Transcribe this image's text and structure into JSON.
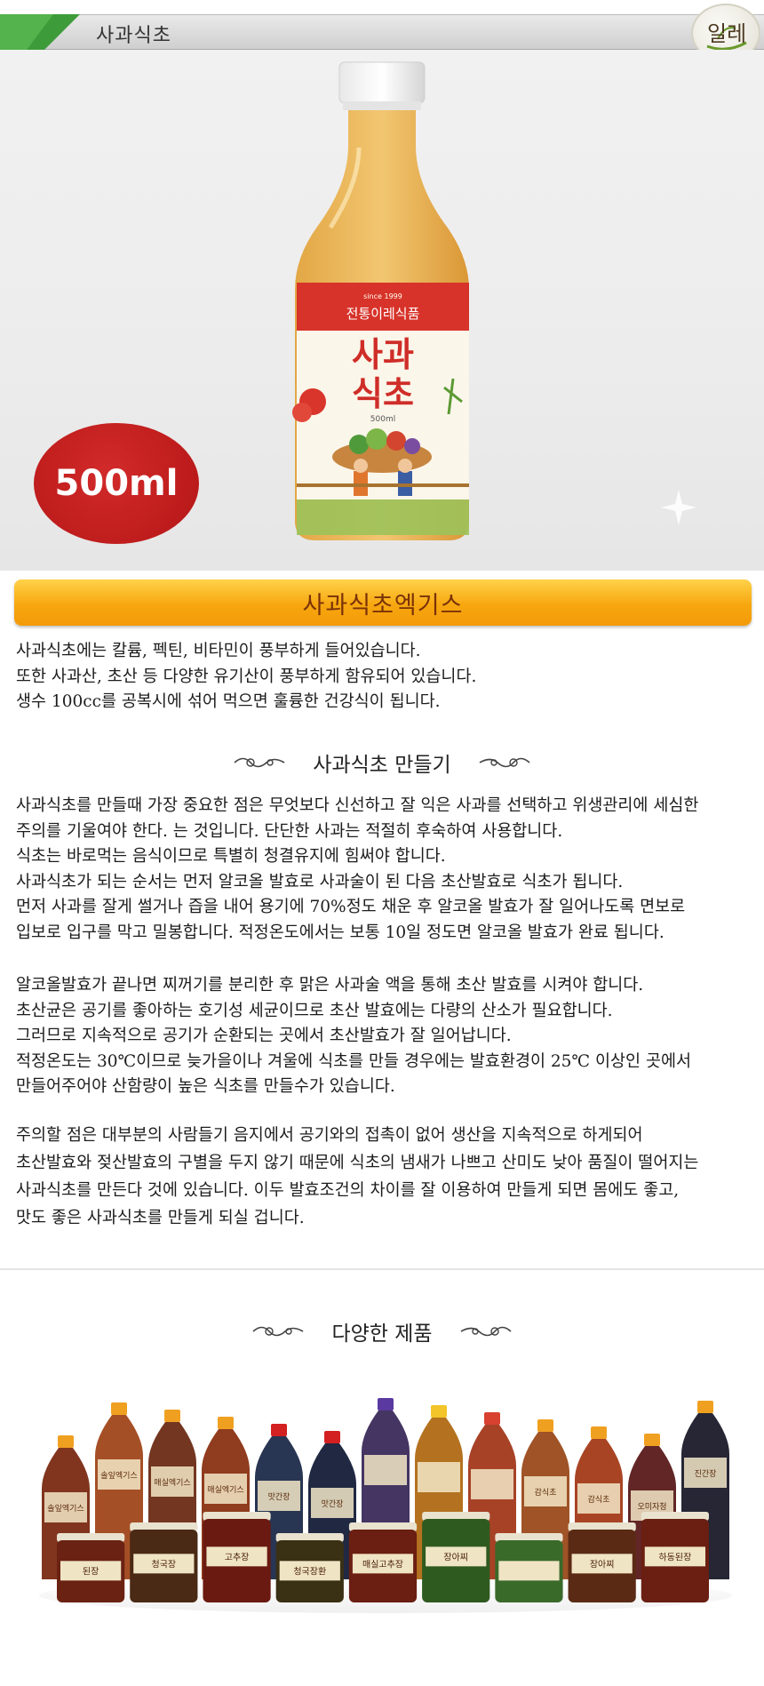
{
  "header": {
    "title": "사과식초",
    "logo_text": "일레",
    "logo_icon": "ilre-logo-icon"
  },
  "hero": {
    "label": {
      "since": "since 1999",
      "brand": "전통이레식품",
      "product_line1": "사과",
      "product_line2": "식초",
      "volume": "500ml"
    },
    "badge": "500ml"
  },
  "extract_section": {
    "heading": "사과식초엑기스",
    "lines": [
      "사과식초에는 칼륨, 펙틴, 비타민이 풍부하게 들어있습니다.",
      "또한 사과산, 초산 등 다양한 유기산이 풍부하게 함유되어 있습니다.",
      "생수 100cc를 공복시에 섞어 먹으면 훌륭한 건강식이 됩니다."
    ]
  },
  "making_section": {
    "heading": "사과식초 만들기",
    "block1": [
      "사과식초를 만들때 가장 중요한 점은 무엇보다 신선하고 잘 익은 사과를 선택하고 위생관리에 세심한",
      "주의를 기울여야 한다. 는 것입니다. 단단한 사과는 적절히 후숙하여 사용합니다.",
      "식초는 바로먹는 음식이므로 특별히 청결유지에 힘써야 합니다.",
      "사과식초가 되는 순서는 먼저 알코올 발효로 사과술이 된 다음 초산발효로 식초가 됩니다.",
      "먼저 사과를 잘게 썰거나 즙을 내어 용기에 70%정도 채운 후 알코올 발효가 잘 일어나도록 면보로",
      "입보로 입구를 막고 밀봉합니다. 적정온도에서는 보통 10일 정도면 알코올 발효가 완료 됩니다."
    ],
    "block2": [
      "알코올발효가 끝나면 찌꺼기를 분리한 후 맑은 사과술 액을 통해 초산 발효를 시켜야 합니다.",
      "초산균은 공기를 좋아하는 호기성 세균이므로 초산 발효에는 다량의 산소가 필요합니다.",
      "그러므로 지속적으로 공기가 순환되는 곳에서 초산발효가 잘 일어납니다.",
      "적정온도는 30℃이므로 늦가을이나 겨울에 식초를 만들 경우에는 발효환경이 25℃ 이상인 곳에서",
      "만들어주어야 산함량이 높은 식초를 만들수가 있습니다."
    ],
    "block3": [
      "주의할 점은 대부분의 사람들기 음지에서 공기와의 접촉이 없어 생산을 지속적으로 하게되어",
      "초산발효와 젖산발효의 구별을 두지 않기 때문에 식초의 냄새가 나쁘고 산미도 낮아 품질이 떨어지는",
      "사과식초를 만든다 것에 있습니다. 이두 발효조건의 차이를 잘 이용하여 만들게 되면 몸에도 좋고,",
      "맛도 좋은 사과식초를 만들게 되실 겁니다."
    ]
  },
  "products_section": {
    "heading": "다양한 제품",
    "bottle_labels": [
      "솔잎엑기스",
      "솔잎엑기스",
      "매실엑기스",
      "매실엑기스",
      "맛간장",
      "맛간장",
      "",
      "",
      "",
      "감식초",
      "감식초",
      "오미자청",
      "진간장"
    ],
    "jar_labels": [
      "된장",
      "청국장",
      "고추장",
      "청국장환",
      "매실고추장",
      "장아찌",
      "",
      "장아찌",
      "하동된장"
    ]
  },
  "colors": {
    "accent_orange": "#f7a70f",
    "badge_red": "#c21f1f",
    "header_green": "#3e9b3a"
  }
}
